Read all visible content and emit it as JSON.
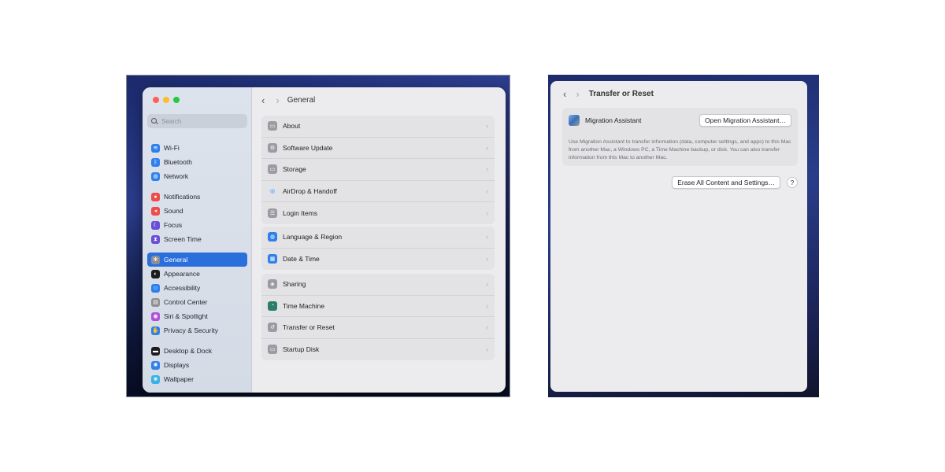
{
  "left": {
    "search": {
      "placeholder": "Search"
    },
    "sidebar": {
      "groups": [
        [
          {
            "label": "Wi-Fi",
            "icon": "wifi-icon",
            "color": "#2f80ed"
          },
          {
            "label": "Bluetooth",
            "icon": "bluetooth-icon",
            "color": "#2f80ed"
          },
          {
            "label": "Network",
            "icon": "globe-icon",
            "color": "#2f80ed"
          }
        ],
        [
          {
            "label": "Notifications",
            "icon": "bell-icon",
            "color": "#ee4b4b"
          },
          {
            "label": "Sound",
            "icon": "speaker-icon",
            "color": "#ee4b4b"
          },
          {
            "label": "Focus",
            "icon": "moon-icon",
            "color": "#6a4fd6"
          },
          {
            "label": "Screen Time",
            "icon": "hourglass-icon",
            "color": "#6a4fd6"
          }
        ],
        [
          {
            "label": "General",
            "icon": "gear-icon",
            "color": "#8e8e93",
            "active": true
          },
          {
            "label": "Appearance",
            "icon": "appearance-icon",
            "color": "#1c1c1e"
          },
          {
            "label": "Accessibility",
            "icon": "accessibility-icon",
            "color": "#2f80ed"
          },
          {
            "label": "Control Center",
            "icon": "control-center-icon",
            "color": "#8e8e93"
          },
          {
            "label": "Siri & Spotlight",
            "icon": "siri-icon",
            "color": "#b050d8"
          },
          {
            "label": "Privacy & Security",
            "icon": "hand-icon",
            "color": "#2f80ed"
          }
        ],
        [
          {
            "label": "Desktop & Dock",
            "icon": "dock-icon",
            "color": "#1c1c1e"
          },
          {
            "label": "Displays",
            "icon": "sun-icon",
            "color": "#2f80ed"
          },
          {
            "label": "Wallpaper",
            "icon": "wallpaper-icon",
            "color": "#3ab0e8"
          }
        ]
      ]
    },
    "main": {
      "title": "General",
      "groups": [
        [
          {
            "label": "About",
            "icon": "about-icon"
          },
          {
            "label": "Software Update",
            "icon": "software-update-icon"
          },
          {
            "label": "Storage",
            "icon": "storage-icon"
          },
          {
            "label": "AirDrop & Handoff",
            "icon": "airdrop-icon"
          },
          {
            "label": "Login Items",
            "icon": "login-items-icon"
          }
        ],
        [
          {
            "label": "Language & Region",
            "icon": "language-icon"
          },
          {
            "label": "Date & Time",
            "icon": "calendar-icon"
          }
        ],
        [
          {
            "label": "Sharing",
            "icon": "sharing-icon"
          },
          {
            "label": "Time Machine",
            "icon": "time-machine-icon"
          },
          {
            "label": "Transfer or Reset",
            "icon": "transfer-reset-icon"
          },
          {
            "label": "Startup Disk",
            "icon": "startup-disk-icon"
          }
        ]
      ]
    }
  },
  "right": {
    "title": "Transfer or Reset",
    "migration": {
      "label": "Migration Assistant",
      "button": "Open Migration Assistant…",
      "description": "Use Migration Assistant to transfer information (data, computer settings, and apps) to this Mac from another Mac, a Windows PC, a Time Machine backup, or disk. You can also transfer information from this Mac to another Mac."
    },
    "erase_button": "Erase All Content and Settings…",
    "help_label": "?"
  }
}
